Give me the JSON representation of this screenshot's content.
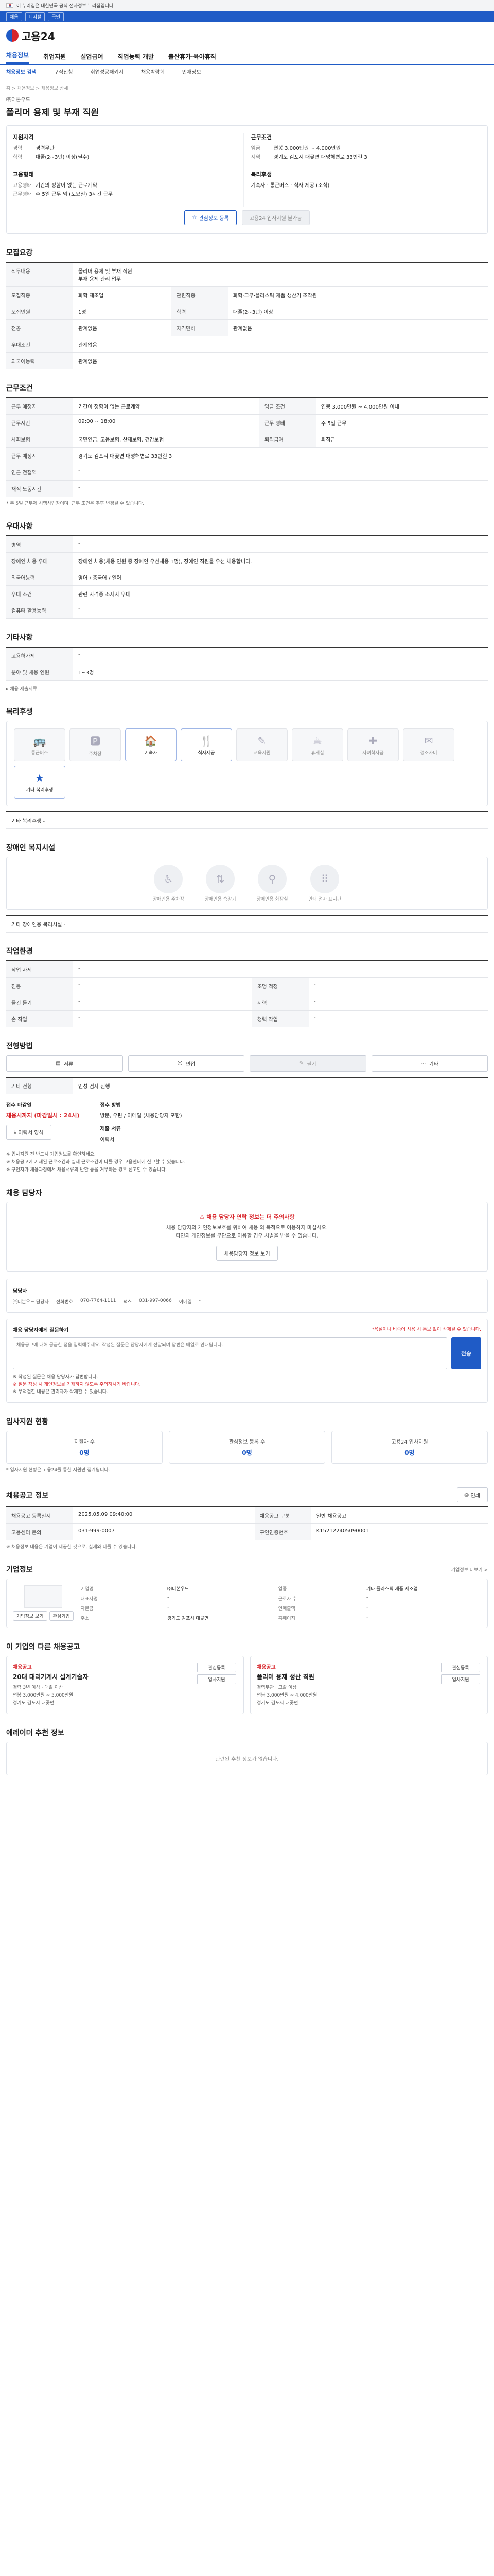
{
  "gov_bar": {
    "text": "이 누리집은 대한민국 공식 전자정부 누리집입니다."
  },
  "quick_links": [
    "채용",
    "디지털",
    "국민"
  ],
  "logo": {
    "text": "고용24"
  },
  "gnb": [
    "채용정보",
    "취업지원",
    "실업급여",
    "직업능력 개발",
    "출산휴가·육아휴직"
  ],
  "lnb": [
    "채용정보 검색",
    "구직신청",
    "취업성공패키지",
    "채용박람회",
    "인재정보",
    "채용정보 검색"
  ],
  "breadcrumb": "홈 > 채용정보 > 채용정보 상세",
  "company_name": "㈜더본우드",
  "job_title": "폴리머 용제 및 부재 직원",
  "summary": {
    "left_groups": [
      {
        "title": "지원자격",
        "rows": [
          {
            "k": "경력",
            "v": "경력무관"
          },
          {
            "k": "학력",
            "v": "대졸(2~3년) 이상(필수)"
          }
        ]
      },
      {
        "title": "고용형태",
        "rows": [
          {
            "k": "고용형태",
            "v": "기간의 정함이 없는 근로계약"
          },
          {
            "k": "근무형태",
            "v": "주 5일 근무 외 (토요일) 3시간 근무"
          }
        ]
      }
    ],
    "right_groups": [
      {
        "title": "근무조건",
        "rows": [
          {
            "k": "임금",
            "v": "연봉 3,000만원 ~ 4,000만원"
          },
          {
            "k": "지역",
            "v": "경기도 김포시 대곶면 대명해변로 33번길 3"
          }
        ]
      },
      {
        "title": "복리후생",
        "rows": [
          {
            "k": "",
            "v": "기숙사 · 통근버스 · 식사 제공 (조식)"
          }
        ]
      }
    ],
    "buttons": {
      "apply": "관심정보 등록",
      "copy": "고용24 입사지원 불가능"
    }
  },
  "sections": {
    "recruit": "모집요강",
    "conditions": "근무조건",
    "duty": "우대사항",
    "etc": "기타사항",
    "welfare": "복리후생",
    "disabled": "장애인 복지시설",
    "environment": "작업환경",
    "method": "전형방법",
    "contact": "채용 담당자",
    "stats": "입사지원 현황",
    "info": "기업정보",
    "reco": "이 기업의 다른 채용공고",
    "similar": "에레이더 추천 정보"
  },
  "recruit_table": {
    "rows": [
      {
        "k": "직무내용",
        "v": "폴리머 용제 및 부재 직원\n부재 용제 관리 업무"
      },
      {
        "k": "모집직종",
        "v": "화학 제조업",
        "k2": "관련직종",
        "v2": "화학·고무·플라스틱 제품 생산기 조작원"
      },
      {
        "k": "모집인원",
        "v": "1명",
        "k2": "학력",
        "v2": "대졸(2~3년) 이상"
      },
      {
        "k": "전공",
        "v": "관계없음",
        "k2": "자격면허",
        "v2": "관계없음"
      },
      {
        "k": "우대조건",
        "v": "관계없음"
      },
      {
        "k": "외국어능력",
        "v": "관계없음"
      }
    ]
  },
  "conditions_table": {
    "rows": [
      {
        "k": "근무 예정지",
        "v": "기간이 정함이 없는 근로계약",
        "k2": "임금 조건",
        "v2": "연봉 3,000만원 ~ 4,000만원 이내"
      },
      {
        "k": "근무시간",
        "v": "09:00 ~ 18:00",
        "k2": "근무 형태",
        "v2": "주 5일 근무"
      },
      {
        "k": "사회보험",
        "v": "국민연금, 고용보험, 산재보험, 건강보험",
        "k2": "퇴직급여",
        "v2": "퇴직금"
      },
      {
        "k": "근무 예정지",
        "v": "경기도 김포시 대곶면 대명해변로 33번길 3"
      },
      {
        "k": "인근 전철역",
        "v": "-"
      },
      {
        "k": "재직 노동시간",
        "v": "-"
      }
    ],
    "note": "* 주 5일 근무제 시행사업장이며, 근무 조건은 추후 변경될 수 있습니다."
  },
  "duty_table": {
    "rows": [
      {
        "k": "병역",
        "v": "-"
      },
      {
        "k": "장애인 채용 우대",
        "v": "장애인 채용(채용 인원 중 장애인 우선채용 1명), 장애인 직원을 우선 채용합니다."
      },
      {
        "k": "외국어능력",
        "v": "영어 / 중국어 / 일어"
      },
      {
        "k": "우대 조건",
        "v": "관련 자격증 소지자 우대"
      },
      {
        "k": "컴퓨터 활용능력",
        "v": "-"
      }
    ]
  },
  "etc_table": {
    "rows": [
      {
        "k": "고용허가제",
        "v": "-"
      },
      {
        "k": "분야 및 채용 인원",
        "v": "1~3명"
      }
    ],
    "link": "▸ 채용 제출서류"
  },
  "welfare_icons": [
    {
      "label": "통근버스",
      "glyph": "🚌",
      "on": false
    },
    {
      "label": "주차장",
      "glyph": "🅿",
      "on": false
    },
    {
      "label": "기숙사",
      "glyph": "🏠",
      "on": true
    },
    {
      "label": "식사제공",
      "glyph": "🍴",
      "on": true
    },
    {
      "label": "교육지원",
      "glyph": "✎",
      "on": false
    },
    {
      "label": "휴게실",
      "glyph": "☕",
      "on": false
    },
    {
      "label": "자녀학자금",
      "glyph": "✚",
      "on": false
    },
    {
      "label": "경조사비",
      "glyph": "✉",
      "on": false
    },
    {
      "label": "기타 복리후생",
      "glyph": "★",
      "on": true
    }
  ],
  "welfare_note": "기타 복리후생 -",
  "disabled_icons": [
    {
      "label": "장애인용 주차장",
      "glyph": "♿"
    },
    {
      "label": "장애인용 승강기",
      "glyph": "⇅"
    },
    {
      "label": "장애인용 화장실",
      "glyph": "⚲"
    },
    {
      "label": "안내 점자 표지판",
      "glyph": "⠿"
    }
  ],
  "disabled_note": "기타 장애인용 복리시설 -",
  "environment_table": {
    "rows": [
      {
        "k": "작업 자세",
        "v": "-",
        "k2": "",
        "v2": ""
      },
      {
        "k": "진동",
        "v": "-",
        "k2": "조명 적정",
        "v2": "-"
      },
      {
        "k": "물건 들기",
        "v": "-",
        "k2": "시력",
        "v2": "-"
      },
      {
        "k": "손 작업",
        "v": "-",
        "k2": "청력 작업",
        "v2": "-"
      }
    ]
  },
  "methods": [
    {
      "label": "서류",
      "on": true
    },
    {
      "label": "면접",
      "on": true
    },
    {
      "label": "필기",
      "on": false
    },
    {
      "label": "기타",
      "on": true
    }
  ],
  "method_extra": {
    "k": "기타 전형",
    "v": "인성 검사 진행"
  },
  "apply": {
    "deadline_label": "접수 마감일",
    "deadline": "채용시까지 (마감일시 : 24시)",
    "way_label": "접수 방법",
    "way": "방문, 우편 / 이메일 (채용담당자 포함)",
    "doc_label": "제출 서류",
    "doc": "이력서",
    "btn": "이력서 양식"
  },
  "apply_notes": [
    "※ 입사지원 전 반드시 기업정보를 확인하세요.",
    "※ 채용공고에 기재된 근로조건과 실제 근로조건이 다를 경우 고용센터에 신고할 수 있습니다.",
    "※ 구인자가 채용과정에서 채용서류의 반환 등을 거부하는 경우 신고할 수 있습니다."
  ],
  "contact": {
    "warn": "채용 담당자 연락 정보는 더 주의사항",
    "warn_sub1": "채용 담당자의 개인정보보호를 위하여 채용 외 목적으로 이용하지 마십시오.",
    "warn_sub2": "타인의 개인정보를 무단으로 이용할 경우 처벌을 받을 수 있습니다.",
    "view_btn": "채용담당자 정보 보기",
    "label": "담당자",
    "name": "㈜더본우드 담당자",
    "phone_k": "전화번호",
    "phone": "070-7764-1111",
    "fax_k": "팩스",
    "fax": "031-997-0066",
    "mail_k": "이메일",
    "mail": "-",
    "qna_title": "채용 담당자에게 질문하기",
    "qna_note": "*욕설이나 비속어 사용 시 통보 없이 삭제될 수 있습니다.",
    "qna_placeholder": "채용공고에 대해 궁금한 점을 입력해주세요. 작성된 질문은 담당자에게 전달되며 답변은 메일로 안내됩니다.",
    "qna_send": "전송",
    "qna_bullets": [
      "※ 작성된 질문은 채용 담당자가 답변합니다.",
      "※ 질문 작성 시 개인정보를 기재하지 않도록 주의하시기 바랍니다.",
      "※ 부적절한 내용은 관리자가 삭제할 수 있습니다."
    ]
  },
  "stats": [
    {
      "label": "지원자 수",
      "value": "0명"
    },
    {
      "label": "관심정보 등록 수",
      "value": "0명"
    },
    {
      "label": "고용24 입사지원",
      "value": "0명"
    }
  ],
  "stats_note": "* 입사지원 현황은 고용24를 통한 지원만 집계됩니다.",
  "posting_info": {
    "title": "채용공고 정보",
    "print_btn": "인쇄",
    "rows": [
      {
        "k": "채용공고 등록일시",
        "v": "2025.05.09 09:40:00",
        "k2": "채용공고 구분",
        "v2": "일반 채용공고"
      },
      {
        "k": "고용센터 문의",
        "v": "031-999-0007",
        "k2": "구인인증번호",
        "v2": "K152122405090001"
      }
    ],
    "note": "※ 채용정보 내용은 기업이 제공한 것으로, 실제와 다를 수 있습니다."
  },
  "company": {
    "view_btn": "기업정보 보기",
    "fav_btn": "관심기업",
    "grid": [
      {
        "k": "기업명",
        "v": "㈜더본우드"
      },
      {
        "k": "업종",
        "v": "기타 플라스틱 제품 제조업"
      },
      {
        "k": "대표자명",
        "v": "-"
      },
      {
        "k": "근로자 수",
        "v": "-"
      },
      {
        "k": "자본금",
        "v": "-"
      },
      {
        "k": "연매출액",
        "v": "-"
      },
      {
        "k": "주소",
        "v": "경기도 김포시 대곶면"
      },
      {
        "k": "홈페이지",
        "v": "-"
      }
    ],
    "more": "기업정보 더보기 >"
  },
  "reco": [
    {
      "tag": "채용공고",
      "name": "20대 대리기계시 설계기술자",
      "lines": [
        "경력 3년 이상 · 대졸 이상",
        "연봉 3,000만원 ~ 5,000만원",
        "경기도 김포시 대곶면"
      ],
      "btns": [
        "관심등록",
        "입사지원"
      ]
    },
    {
      "tag": "채용공고",
      "name": "폴리머 용제 생산 직원",
      "lines": [
        "경력무관 · 고졸 이상",
        "연봉 3,000만원 ~ 4,000만원",
        "경기도 김포시 대곶면"
      ],
      "btns": [
        "관심등록",
        "입사지원"
      ]
    }
  ],
  "similar_nodata": "관련된 추천 정보가 없습니다."
}
